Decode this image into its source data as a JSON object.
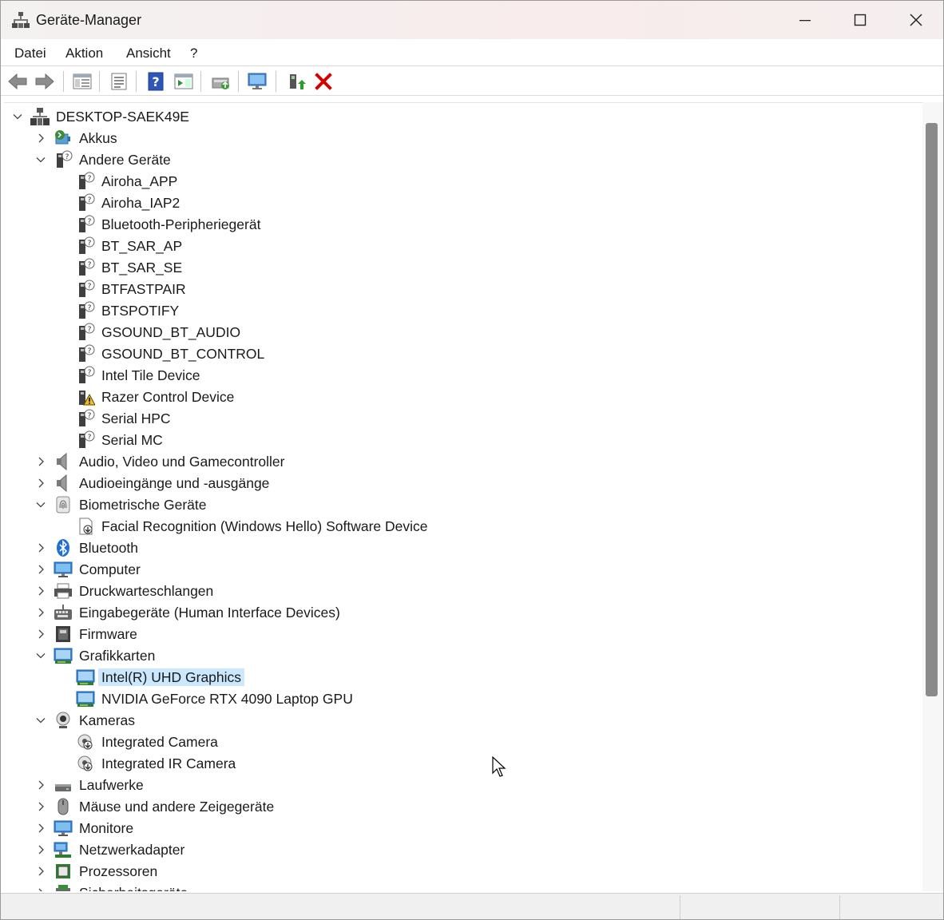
{
  "window": {
    "title": "Geräte-Manager"
  },
  "menu": [
    "Datei",
    "Aktion",
    "Ansicht",
    "?"
  ],
  "toolbar": [
    "back-icon",
    "forward-icon",
    "console-tree-icon",
    "properties-icon",
    "help-icon",
    "action-pane-icon",
    "update-driver-icon",
    "scan-hardware-icon",
    "enable-device-icon",
    "uninstall-icon"
  ],
  "tree": [
    {
      "label": "DESKTOP-SAEK49E",
      "level": 0,
      "expanded": true,
      "icon": "computer-root-icon"
    },
    {
      "label": "Akkus",
      "level": 1,
      "expanded": false,
      "icon": "battery-icon"
    },
    {
      "label": "Andere Geräte",
      "level": 1,
      "expanded": true,
      "icon": "unknown-device-icon"
    },
    {
      "label": "Airoha_APP",
      "level": 2,
      "icon": "unknown-device-icon"
    },
    {
      "label": "Airoha_IAP2",
      "level": 2,
      "icon": "unknown-device-icon"
    },
    {
      "label": "Bluetooth-Peripheriegerät",
      "level": 2,
      "icon": "unknown-device-icon"
    },
    {
      "label": "BT_SAR_AP",
      "level": 2,
      "icon": "unknown-device-icon"
    },
    {
      "label": "BT_SAR_SE",
      "level": 2,
      "icon": "unknown-device-icon"
    },
    {
      "label": "BTFASTPAIR",
      "level": 2,
      "icon": "unknown-device-icon"
    },
    {
      "label": "BTSPOTIFY",
      "level": 2,
      "icon": "unknown-device-icon"
    },
    {
      "label": "GSOUND_BT_AUDIO",
      "level": 2,
      "icon": "unknown-device-icon"
    },
    {
      "label": "GSOUND_BT_CONTROL",
      "level": 2,
      "icon": "unknown-device-icon"
    },
    {
      "label": "Intel Tile Device",
      "level": 2,
      "icon": "unknown-device-icon"
    },
    {
      "label": "Razer Control Device",
      "level": 2,
      "icon": "warning-device-icon"
    },
    {
      "label": "Serial HPC",
      "level": 2,
      "icon": "unknown-device-icon"
    },
    {
      "label": "Serial MC",
      "level": 2,
      "icon": "unknown-device-icon"
    },
    {
      "label": "Audio, Video und Gamecontroller",
      "level": 1,
      "expanded": false,
      "icon": "speaker-icon"
    },
    {
      "label": "Audioeingänge und -ausgänge",
      "level": 1,
      "expanded": false,
      "icon": "speaker-icon"
    },
    {
      "label": "Biometrische Geräte",
      "level": 1,
      "expanded": true,
      "icon": "fingerprint-icon"
    },
    {
      "label": "Facial Recognition (Windows Hello) Software Device",
      "level": 2,
      "icon": "software-device-icon"
    },
    {
      "label": "Bluetooth",
      "level": 1,
      "expanded": false,
      "icon": "bluetooth-icon"
    },
    {
      "label": "Computer",
      "level": 1,
      "expanded": false,
      "icon": "monitor-icon"
    },
    {
      "label": "Druckwarteschlangen",
      "level": 1,
      "expanded": false,
      "icon": "printer-icon"
    },
    {
      "label": "Eingabegeräte (Human Interface Devices)",
      "level": 1,
      "expanded": false,
      "icon": "hid-icon"
    },
    {
      "label": "Firmware",
      "level": 1,
      "expanded": false,
      "icon": "firmware-icon"
    },
    {
      "label": "Grafikkarten",
      "level": 1,
      "expanded": true,
      "icon": "display-adapter-icon"
    },
    {
      "label": "Intel(R) UHD Graphics",
      "level": 2,
      "selected": true,
      "icon": "display-adapter-icon"
    },
    {
      "label": "NVIDIA GeForce RTX 4090 Laptop GPU",
      "level": 2,
      "icon": "display-adapter-icon"
    },
    {
      "label": "Kameras",
      "level": 1,
      "expanded": true,
      "icon": "webcam-icon"
    },
    {
      "label": "Integrated Camera",
      "level": 2,
      "icon": "camera-device-icon"
    },
    {
      "label": "Integrated IR Camera",
      "level": 2,
      "icon": "camera-device-icon"
    },
    {
      "label": "Laufwerke",
      "level": 1,
      "expanded": false,
      "icon": "drive-icon"
    },
    {
      "label": "Mäuse und andere Zeigegeräte",
      "level": 1,
      "expanded": false,
      "icon": "mouse-icon"
    },
    {
      "label": "Monitore",
      "level": 1,
      "expanded": false,
      "icon": "monitor-icon"
    },
    {
      "label": "Netzwerkadapter",
      "level": 1,
      "expanded": false,
      "icon": "network-icon"
    },
    {
      "label": "Prozessoren",
      "level": 1,
      "expanded": false,
      "icon": "cpu-icon"
    },
    {
      "label": "Sicherheitsgeräte",
      "level": 1,
      "expanded": false,
      "icon": "security-icon"
    }
  ],
  "colors": {
    "selection": "#cce8ff",
    "accent": "#0078d4",
    "error": "#d40000"
  }
}
